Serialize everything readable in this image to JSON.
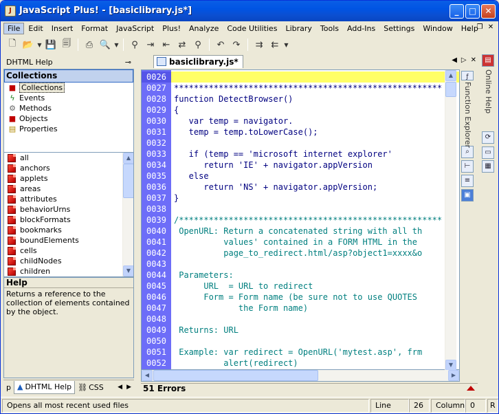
{
  "window": {
    "title": "JavaScript Plus! - [basiclibrary.js*]",
    "app_icon": "app-icon"
  },
  "menu": [
    "File",
    "Edit",
    "Insert",
    "Format",
    "JavaScript",
    "Plus!",
    "Analyze",
    "Code Utilities",
    "Library",
    "Tools",
    "Add-Ins",
    "Settings",
    "Window",
    "Help"
  ],
  "toolbar": {
    "icons": [
      "new-file-icon",
      "open-folder-icon",
      "save-icon",
      "save-all-icon",
      "print-icon",
      "print-preview-icon",
      "binoculars-find-icon",
      "find-next-icon",
      "find-previous-icon",
      "replace-icon",
      "find-in-files-icon",
      "undo-icon",
      "redo-icon",
      "indent-icon",
      "outdent-icon"
    ]
  },
  "left_panel": {
    "header": "DHTML Help",
    "pin_icon": "pushpin-icon",
    "collections_title": "Collections",
    "categories": [
      {
        "label": "Collections",
        "icon": "cube-icon"
      },
      {
        "label": "Events",
        "icon": "lightning-icon"
      },
      {
        "label": "Methods",
        "icon": "method-icon"
      },
      {
        "label": "Objects",
        "icon": "cube-icon"
      },
      {
        "label": "Properties",
        "icon": "properties-icon"
      }
    ],
    "members": [
      "all",
      "anchors",
      "applets",
      "areas",
      "attributes",
      "behaviorUrns",
      "blockFormats",
      "bookmarks",
      "boundElements",
      "cells",
      "childNodes",
      "children"
    ],
    "help_title": "Help",
    "help_text": "Returns a reference to the collection of elements contained by the object.",
    "tabs": [
      "p",
      "DHTML Help",
      "CSS"
    ]
  },
  "editor": {
    "tab_label": "basiclibrary.js*",
    "errors_label": "51 Errors",
    "lines": [
      {
        "n": "0026",
        "t": "",
        "cur": true
      },
      {
        "n": "0027",
        "t": "******************************************************"
      },
      {
        "n": "0028",
        "t": "function DetectBrowser()"
      },
      {
        "n": "0029",
        "t": "{"
      },
      {
        "n": "0030",
        "t": "   var temp = navigator."
      },
      {
        "n": "0031",
        "t": "   temp = temp.toLowerCase();"
      },
      {
        "n": "0032",
        "t": ""
      },
      {
        "n": "0033",
        "t": "   if (temp == 'microsoft internet explorer'"
      },
      {
        "n": "0034",
        "t": "      return 'IE' + navigator.appVersion"
      },
      {
        "n": "0035",
        "t": "   else"
      },
      {
        "n": "0036",
        "t": "      return 'NS' + navigator.appVersion;"
      },
      {
        "n": "0037",
        "t": "}"
      },
      {
        "n": "0038",
        "t": ""
      },
      {
        "n": "0039",
        "t": "/*****************************************************",
        "c": true
      },
      {
        "n": "0040",
        "t": " OpenURL: Return a concatenated string with all th",
        "c": true
      },
      {
        "n": "0041",
        "t": "          values' contained in a FORM HTML in the",
        "c": true
      },
      {
        "n": "0042",
        "t": "          page_to_redirect.html/asp?object1=xxxx&o",
        "c": true
      },
      {
        "n": "0043",
        "t": "",
        "c": true
      },
      {
        "n": "0044",
        "t": " Parameters:",
        "c": true
      },
      {
        "n": "0045",
        "t": "      URL  = URL to redirect",
        "c": true
      },
      {
        "n": "0046",
        "t": "      Form = Form name (be sure not to use QUOTES",
        "c": true
      },
      {
        "n": "0047",
        "t": "             the Form name)",
        "c": true
      },
      {
        "n": "0048",
        "t": "",
        "c": true
      },
      {
        "n": "0049",
        "t": " Returns: URL",
        "c": true
      },
      {
        "n": "0050",
        "t": "",
        "c": true
      },
      {
        "n": "0051",
        "t": " Example: var redirect = OpenURL('mytest.asp', frm",
        "c": true
      },
      {
        "n": "0052",
        "t": "          alert(redirect)",
        "c": true
      }
    ]
  },
  "side_panels": {
    "function_explorer": "Function Explorer",
    "online_help": "Online Help"
  },
  "statusbar": {
    "message": "Opens all most recent used files",
    "line_label": "Line",
    "line_value": "26",
    "column_label": "Column",
    "column_value": "0",
    "extra": "R"
  },
  "colors": {
    "titlebar": "#0054e3",
    "gutter": "#6d6df8",
    "current_line": "#ffff66",
    "comment": "#007f7f"
  }
}
